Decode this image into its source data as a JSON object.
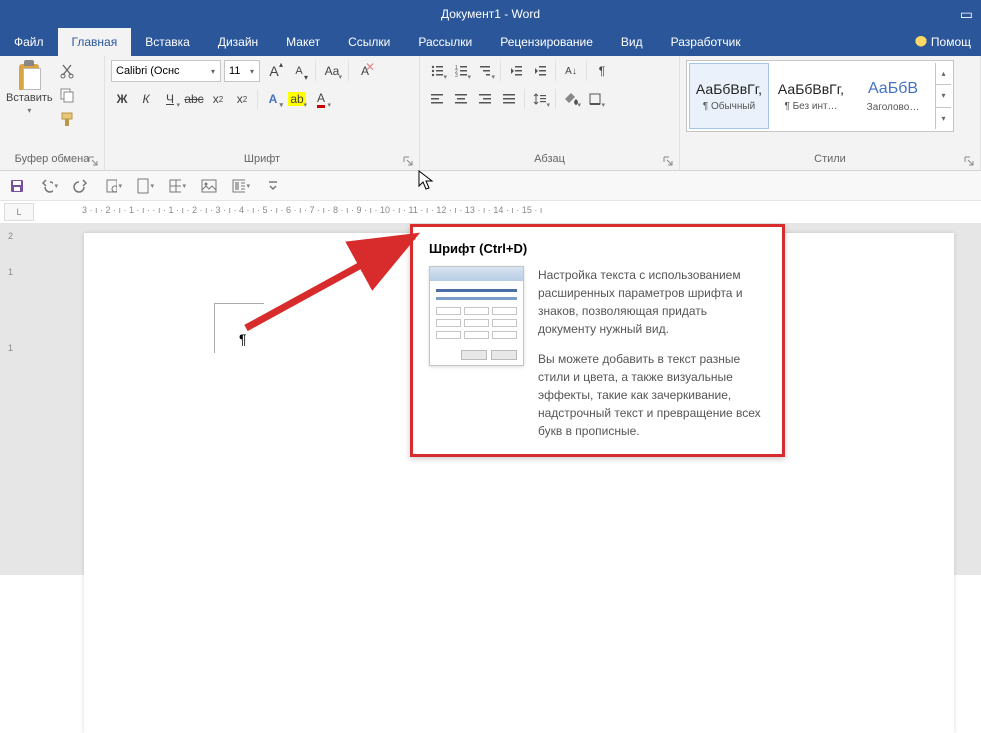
{
  "title": "Документ1 - Word",
  "tabs": {
    "file": "Файл",
    "home": "Главная",
    "insert": "Вставка",
    "design": "Дизайн",
    "layout": "Макет",
    "references": "Ссылки",
    "mailings": "Рассылки",
    "review": "Рецензирование",
    "view": "Вид",
    "developer": "Разработчик",
    "help": "Помощ"
  },
  "clipboard": {
    "paste": "Вставить",
    "group_label": "Буфер обмена"
  },
  "font": {
    "name": "Calibri (Оснс",
    "size": "11",
    "group_label": "Шрифт"
  },
  "paragraph": {
    "group_label": "Абзац"
  },
  "styles": {
    "group_label": "Стили",
    "sample": "АаБбВвГг,",
    "sample_big": "АаБбВ",
    "normal": "¶ Обычный",
    "no_spacing": "¶ Без инт…",
    "heading1": "Заголово…"
  },
  "ruler": {
    "horizontal": "3 · ı · 2 · ı · 1 · ı ·     · ı · 1 · ı · 2 · ı · 3 · ı · 4 · ı · 5 · ı · 6 · ı · 7 · ı · 8 · ı · 9 · ı · 10 · ı · 11 · ı · 12 · ı · 13 · ı · 14 · ı · 15 · ı",
    "corner": "L"
  },
  "tooltip": {
    "title": "Шрифт (Ctrl+D)",
    "p1": "Настройка текста с использованием расширенных параметров шрифта и знаков, позволяющая придать документу нужный вид.",
    "p2": "Вы можете добавить в текст разные стили и цвета, а также визуальные эффекты, такие как зачеркивание, надстрочный текст и превращение всех букв в прописные."
  },
  "vruler": {
    "n2": "2",
    "n1": "1"
  }
}
